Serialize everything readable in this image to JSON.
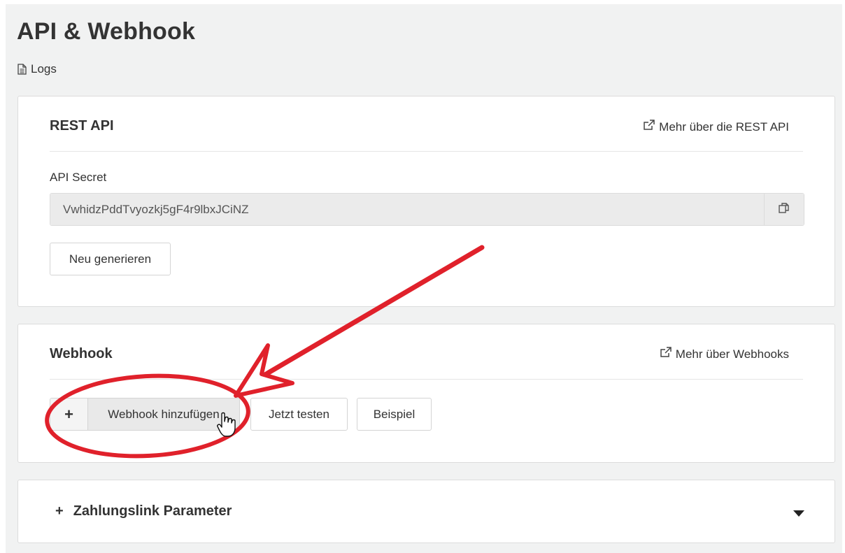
{
  "page": {
    "title": "API & Webhook",
    "logs_label": "Logs"
  },
  "rest_api": {
    "title": "REST API",
    "more_link": "Mehr über die REST API",
    "secret_label": "API Secret",
    "secret_value": "VwhidzPddTvyozkj5gF4r9lbxJCiNZ",
    "regenerate_label": "Neu generieren"
  },
  "webhook": {
    "title": "Webhook",
    "more_link": "Mehr über Webhooks",
    "add_plus": "+",
    "add_label": "Webhook hinzufügen",
    "test_label": "Jetzt testen",
    "example_label": "Beispiel"
  },
  "payment_link": {
    "plus": "+",
    "title": "Zahlungslink Parameter"
  },
  "annotation": {
    "color": "#e0212b"
  },
  "icons": {
    "logs": "document-icon",
    "external": "external-link-icon",
    "copy": "copy-icon",
    "caret": "caret-down-icon",
    "cursor": "hand-pointer-icon"
  }
}
